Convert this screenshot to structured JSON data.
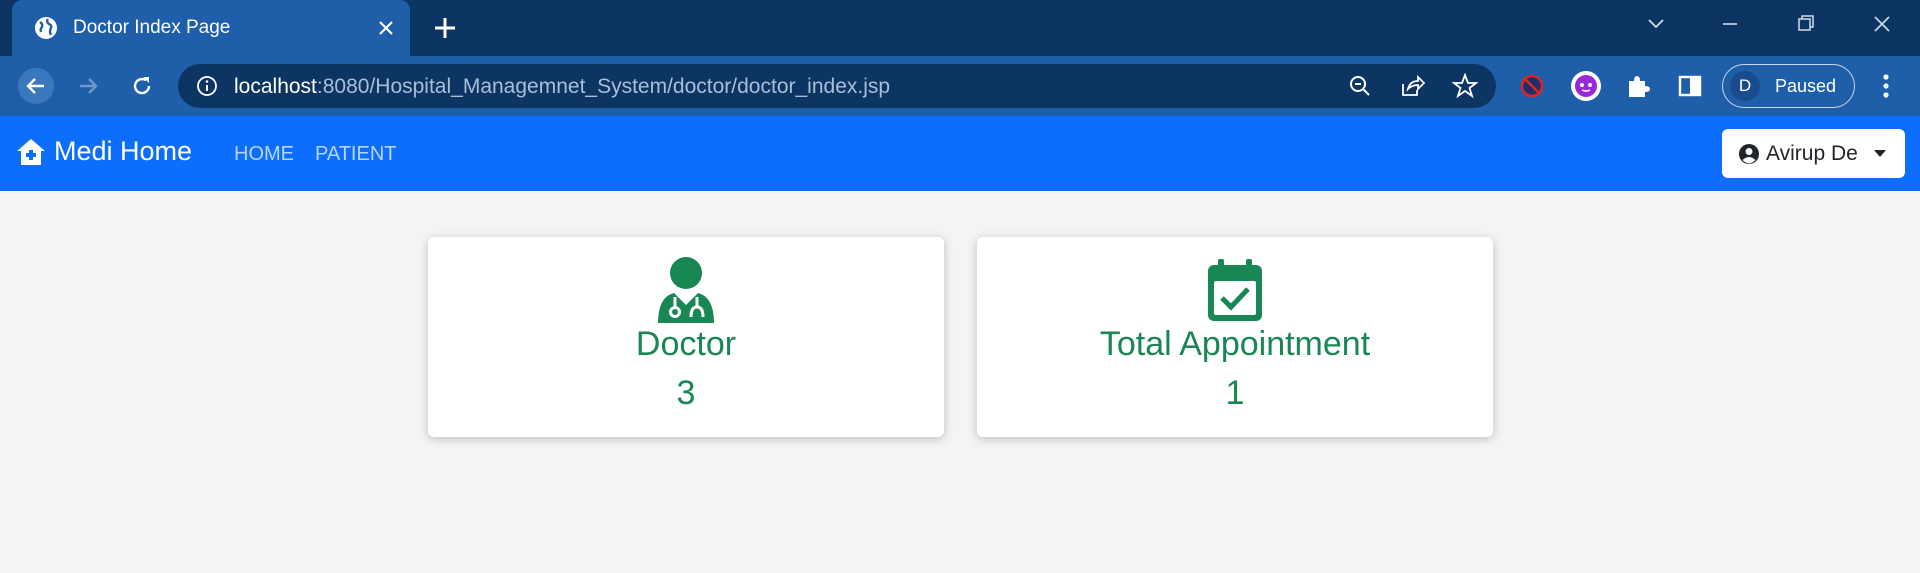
{
  "browser": {
    "tab_title": "Doctor Index Page",
    "url_host": "localhost",
    "url_path": ":8080/Hospital_Managemnet_System/doctor/doctor_index.jsp",
    "profile_initial": "D",
    "profile_status": "Paused"
  },
  "navbar": {
    "brand": "Medi Home",
    "links": [
      {
        "label": "HOME"
      },
      {
        "label": "PATIENT"
      }
    ],
    "user_name": "Avirup De"
  },
  "cards": [
    {
      "title": "Doctor",
      "value": "3",
      "icon": "user-doctor-icon"
    },
    {
      "title": "Total Appointment",
      "value": "1",
      "icon": "calendar-check-icon"
    }
  ],
  "colors": {
    "chrome_dark": "#0d3563",
    "chrome_light": "#1f5ea8",
    "navbar": "#0d6efd",
    "accent_green": "#198754",
    "page_bg": "#f4f4f4"
  }
}
